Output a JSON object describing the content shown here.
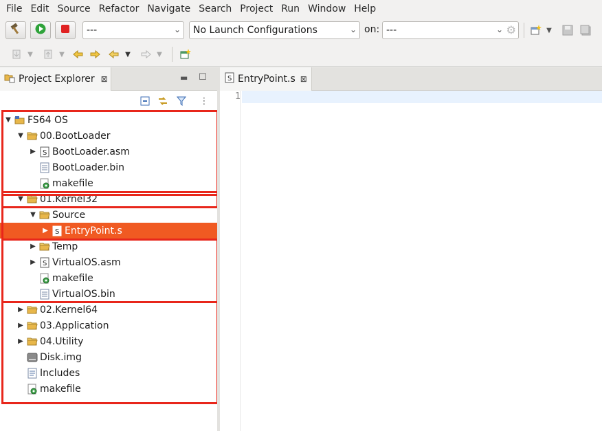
{
  "menu": [
    "File",
    "Edit",
    "Source",
    "Refactor",
    "Navigate",
    "Search",
    "Project",
    "Run",
    "Window",
    "Help"
  ],
  "toolbar": {
    "build_icon": "hammer-icon",
    "run_icon": "run-icon",
    "stop_icon": "stop-icon",
    "launch_mode_value": "---",
    "launch_config_value": "No Launch Configurations",
    "on_label": "on:",
    "target_value": "---"
  },
  "project_explorer": {
    "title": "Project Explorer",
    "close_glyph": "⊠",
    "tree": [
      {
        "label": "FS64 OS",
        "indent": 0,
        "twisty": "open",
        "icon": "project"
      },
      {
        "label": "00.BootLoader",
        "indent": 1,
        "twisty": "open",
        "icon": "folder"
      },
      {
        "label": "BootLoader.asm",
        "indent": 2,
        "twisty": "closed",
        "icon": "source-file"
      },
      {
        "label": "BootLoader.bin",
        "indent": 2,
        "twisty": "none",
        "icon": "text-file"
      },
      {
        "label": "makefile",
        "indent": 2,
        "twisty": "none",
        "icon": "makefile"
      },
      {
        "label": "01.Kernel32",
        "indent": 1,
        "twisty": "open",
        "icon": "folder"
      },
      {
        "label": "Source",
        "indent": 2,
        "twisty": "open",
        "icon": "folder"
      },
      {
        "label": "EntryPoint.s",
        "indent": 3,
        "twisty": "closed",
        "icon": "source-file",
        "selected": true
      },
      {
        "label": "Temp",
        "indent": 2,
        "twisty": "closed",
        "icon": "folder"
      },
      {
        "label": "VirtualOS.asm",
        "indent": 2,
        "twisty": "closed",
        "icon": "source-file"
      },
      {
        "label": "makefile",
        "indent": 2,
        "twisty": "none",
        "icon": "makefile"
      },
      {
        "label": "VirtualOS.bin",
        "indent": 2,
        "twisty": "none",
        "icon": "text-file"
      },
      {
        "label": "02.Kernel64",
        "indent": 1,
        "twisty": "closed",
        "icon": "folder"
      },
      {
        "label": "03.Application",
        "indent": 1,
        "twisty": "closed",
        "icon": "folder"
      },
      {
        "label": "04.Utility",
        "indent": 1,
        "twisty": "closed",
        "icon": "folder"
      },
      {
        "label": "Disk.img",
        "indent": 1,
        "twisty": "none",
        "icon": "disk-image"
      },
      {
        "label": "Includes",
        "indent": 1,
        "twisty": "none",
        "icon": "includes"
      },
      {
        "label": "makefile",
        "indent": 1,
        "twisty": "none",
        "icon": "makefile"
      }
    ]
  },
  "editor": {
    "tab_label": "EntryPoint.s",
    "line_numbers": [
      "1"
    ]
  },
  "colors": {
    "selection": "#f05a22",
    "highlight_box": "#e8261b",
    "folder": "#e8b74a",
    "current_line": "#e8f2fe"
  }
}
